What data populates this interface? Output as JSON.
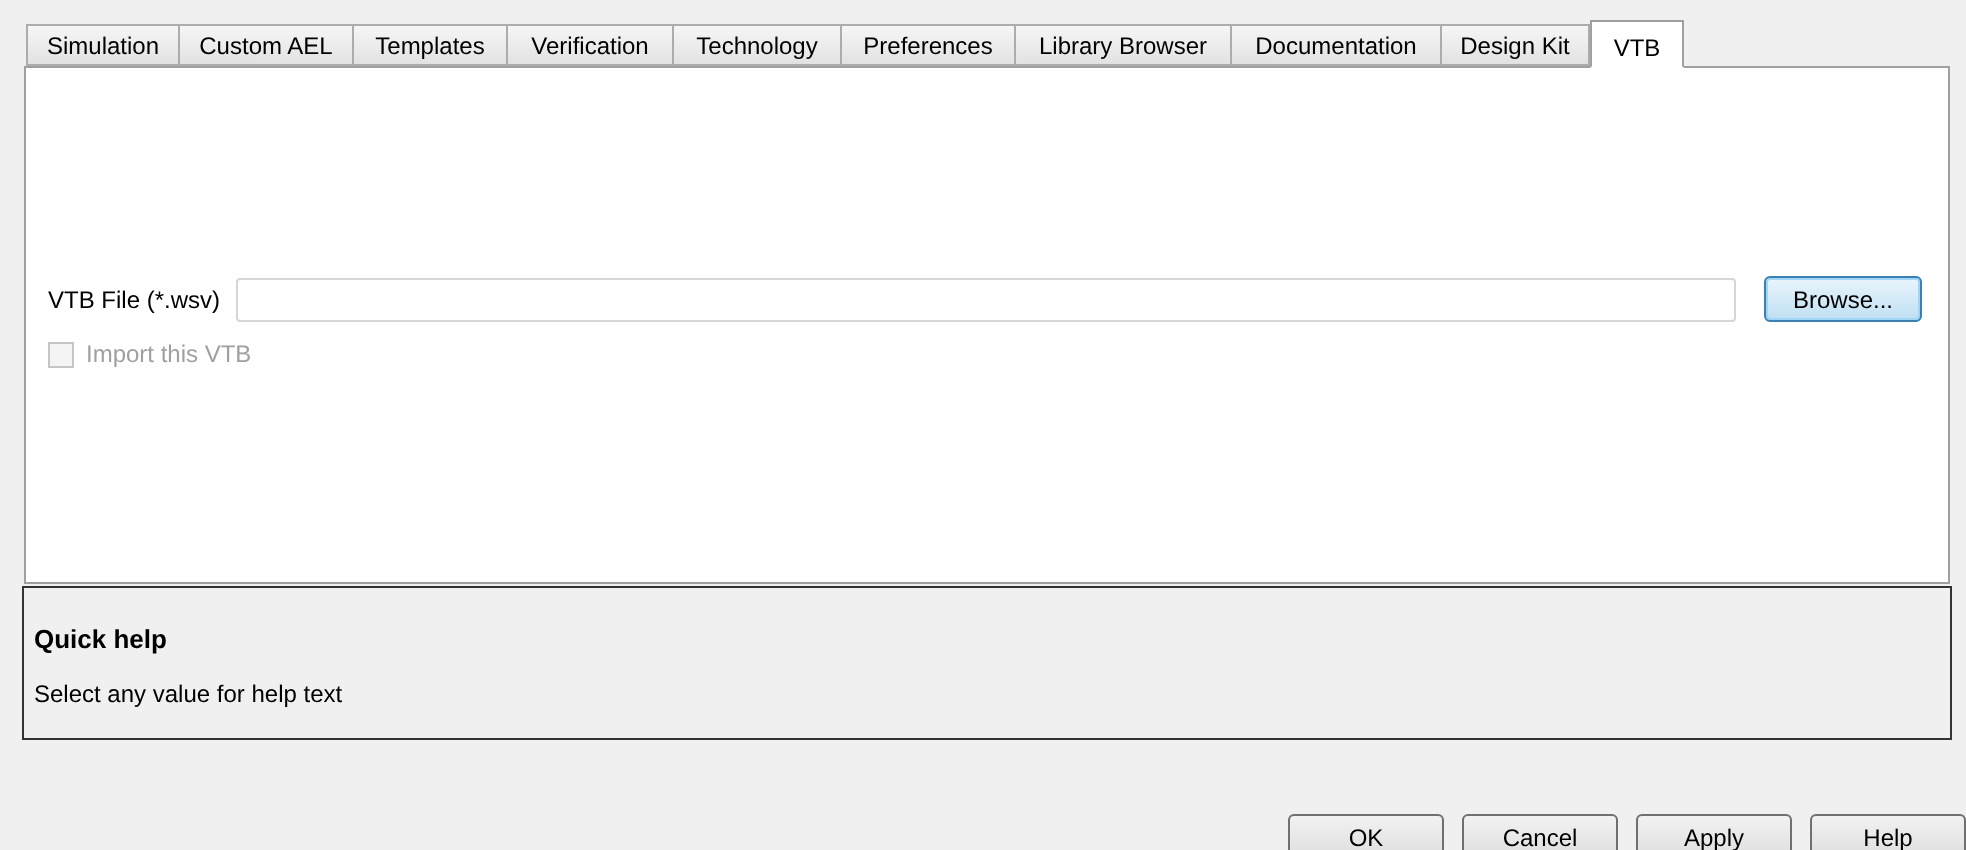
{
  "tabs": [
    {
      "label": "Simulation",
      "selected": false
    },
    {
      "label": "Custom AEL",
      "selected": false
    },
    {
      "label": "Templates",
      "selected": false
    },
    {
      "label": "Verification",
      "selected": false
    },
    {
      "label": "Technology",
      "selected": false
    },
    {
      "label": "Preferences",
      "selected": false
    },
    {
      "label": "Library Browser",
      "selected": false
    },
    {
      "label": "Documentation",
      "selected": false
    },
    {
      "label": "Design Kit",
      "selected": false
    },
    {
      "label": "VTB",
      "selected": true
    }
  ],
  "vtb_file": {
    "label": "VTB File (*.wsv)",
    "browse_button": "Browse..."
  },
  "import_checkbox": {
    "label": "Import this VTB",
    "checked": false,
    "disabled": true
  },
  "quick_help": {
    "title": "Quick help",
    "text": "Select any value for help text"
  },
  "buttons": [
    "OK",
    "Cancel",
    "Apply",
    "Help"
  ]
}
